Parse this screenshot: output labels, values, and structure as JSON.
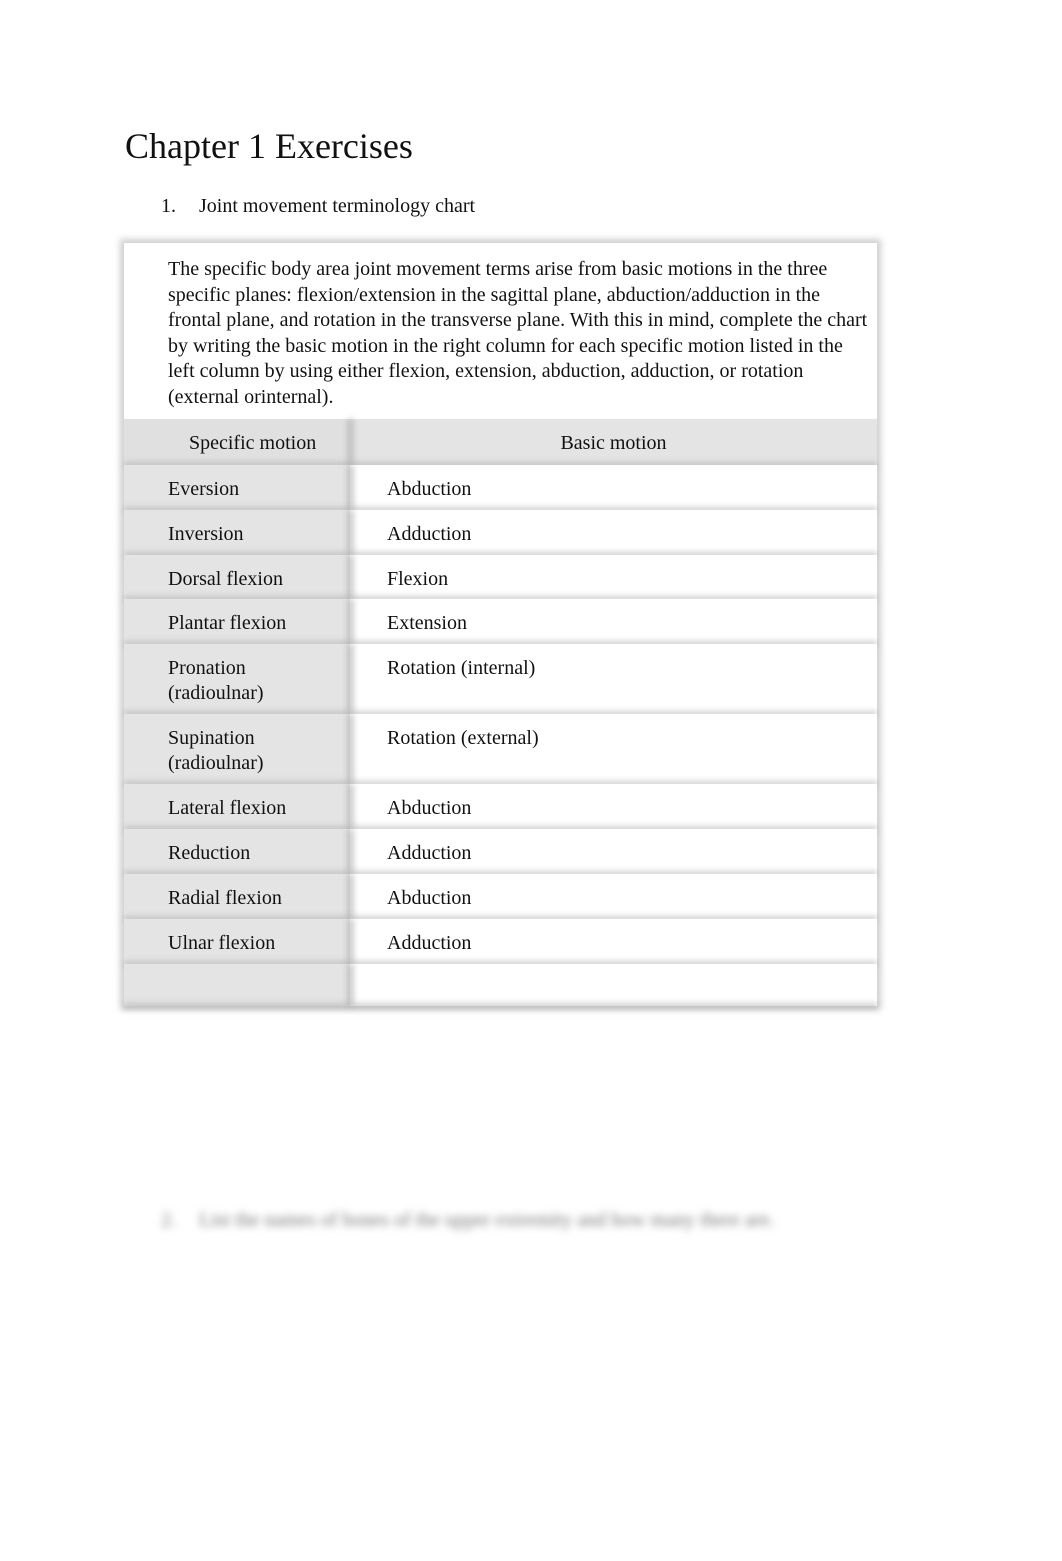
{
  "page": {
    "title": "Chapter 1 Exercises",
    "items": [
      {
        "number": "1.",
        "text": "Joint movement terminology chart"
      },
      {
        "number": "2.",
        "text": "List the names of bones of the upper extremity and how many there are."
      }
    ]
  },
  "chart": {
    "intro": "The specific body area joint movement terms arise from basic motions in the three specific planes: flexion/extension in the sagittal plane, abduction/adduction in the frontal plane, and rotation in the transverse plane. With this in mind, complete the chart by writing the basic motion in the right column for each specific motion listed in the left column by using either flexion, extension, abduction, adduction, or rotation (external orinternal).",
    "headers": {
      "specific": "Specific motion",
      "basic": "Basic motion"
    },
    "rows": [
      {
        "specific": "Eversion",
        "basic": "Abduction"
      },
      {
        "specific": "Inversion",
        "basic": "Adduction"
      },
      {
        "specific": "Dorsal flexion",
        "basic": "Flexion"
      },
      {
        "specific": "Plantar flexion",
        "basic": "Extension"
      },
      {
        "specific": "Pronation (radioulnar)",
        "basic": "Rotation (internal)"
      },
      {
        "specific": "Supination (radioulnar)",
        "basic": "Rotation (external)"
      },
      {
        "specific": "Lateral flexion",
        "basic": "Abduction"
      },
      {
        "specific": "Reduction",
        "basic": "Adduction"
      },
      {
        "specific": "Radial flexion",
        "basic": "Abduction"
      },
      {
        "specific": "Ulnar flexion",
        "basic": "Adduction"
      },
      {
        "specific": "",
        "basic": ""
      }
    ]
  }
}
